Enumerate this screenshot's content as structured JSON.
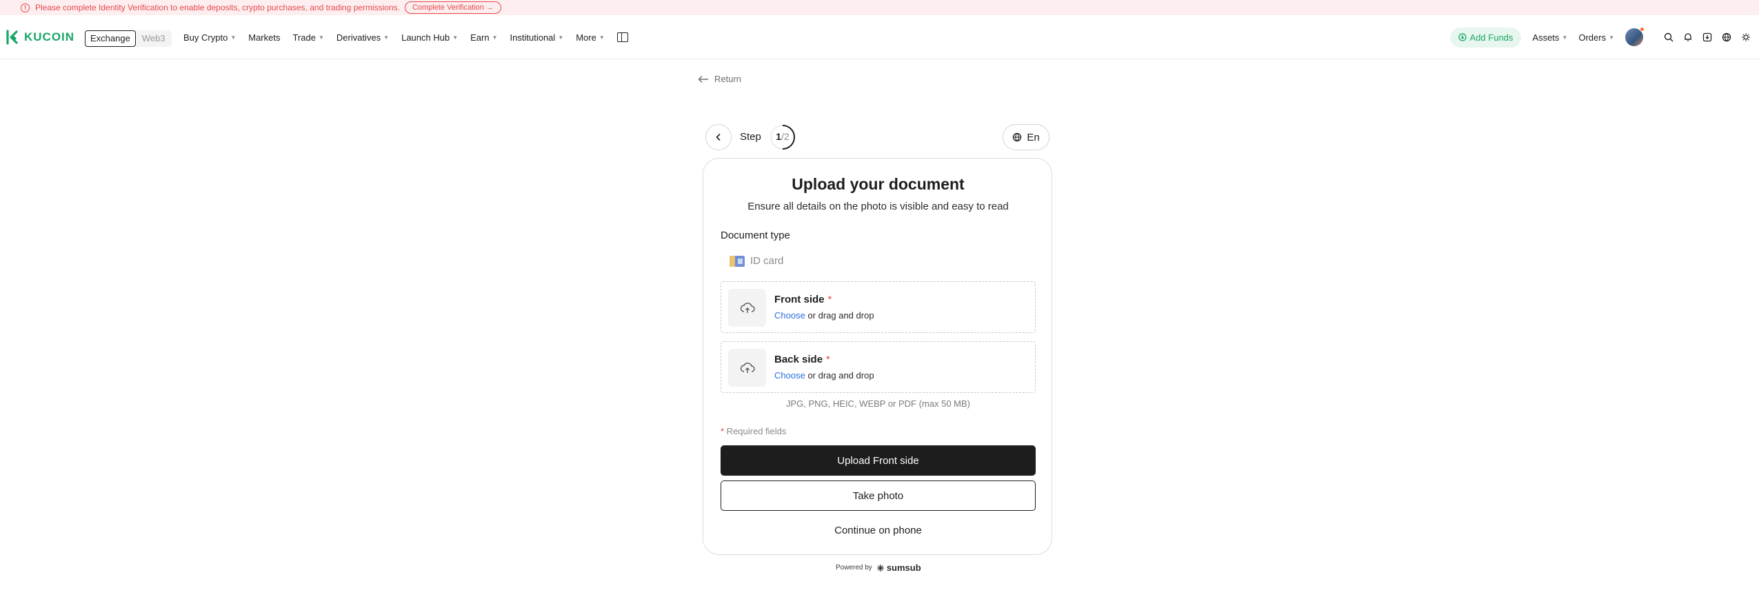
{
  "notice": {
    "text": "Please complete Identity Verification to enable deposits, crypto purchases, and trading permissions.",
    "cta": "Complete Verification",
    "cta_arrow": "→"
  },
  "header": {
    "logo": "KUCOIN",
    "segment": {
      "active": "Exchange",
      "inactive": "Web3"
    },
    "nav": [
      {
        "label": "Buy Crypto",
        "caret": true
      },
      {
        "label": "Markets",
        "caret": false
      },
      {
        "label": "Trade",
        "caret": true
      },
      {
        "label": "Derivatives",
        "caret": true
      },
      {
        "label": "Launch Hub",
        "caret": true
      },
      {
        "label": "Earn",
        "caret": true
      },
      {
        "label": "Institutional",
        "caret": true
      },
      {
        "label": "More",
        "caret": true
      }
    ],
    "add_funds": "Add Funds",
    "assets": "Assets",
    "orders": "Orders",
    "icons": [
      "search-icon",
      "bell-icon",
      "download-icon",
      "globe-icon",
      "theme-icon"
    ]
  },
  "return_label": "Return",
  "stepper": {
    "label": "Step",
    "current": "1",
    "total": "/2",
    "progress_fraction": 0.5
  },
  "language": "En",
  "card": {
    "title": "Upload your document",
    "subtitle": "Ensure all details on the photo is visible and easy to read",
    "doc_type_label": "Document type",
    "doc_type_value": "ID card",
    "front": {
      "title": "Front side",
      "required": "*",
      "choose": "Choose",
      "hint": " or drag and drop"
    },
    "back": {
      "title": "Back side",
      "required": "*",
      "choose": "Choose",
      "hint": " or drag and drop"
    },
    "formats": "JPG, PNG, HEIC, WEBP or PDF (max 50 MB)",
    "required_mark": "*",
    "required_text": " Required fields",
    "primary_button": "Upload Front side",
    "secondary_button": "Take photo",
    "link_button": "Continue on phone"
  },
  "powered": {
    "label": "Powered by",
    "brand": "sumsub"
  },
  "colors": {
    "brand_green": "#17a765",
    "alert_red": "#e5484d",
    "link_blue": "#2a6fdb"
  }
}
